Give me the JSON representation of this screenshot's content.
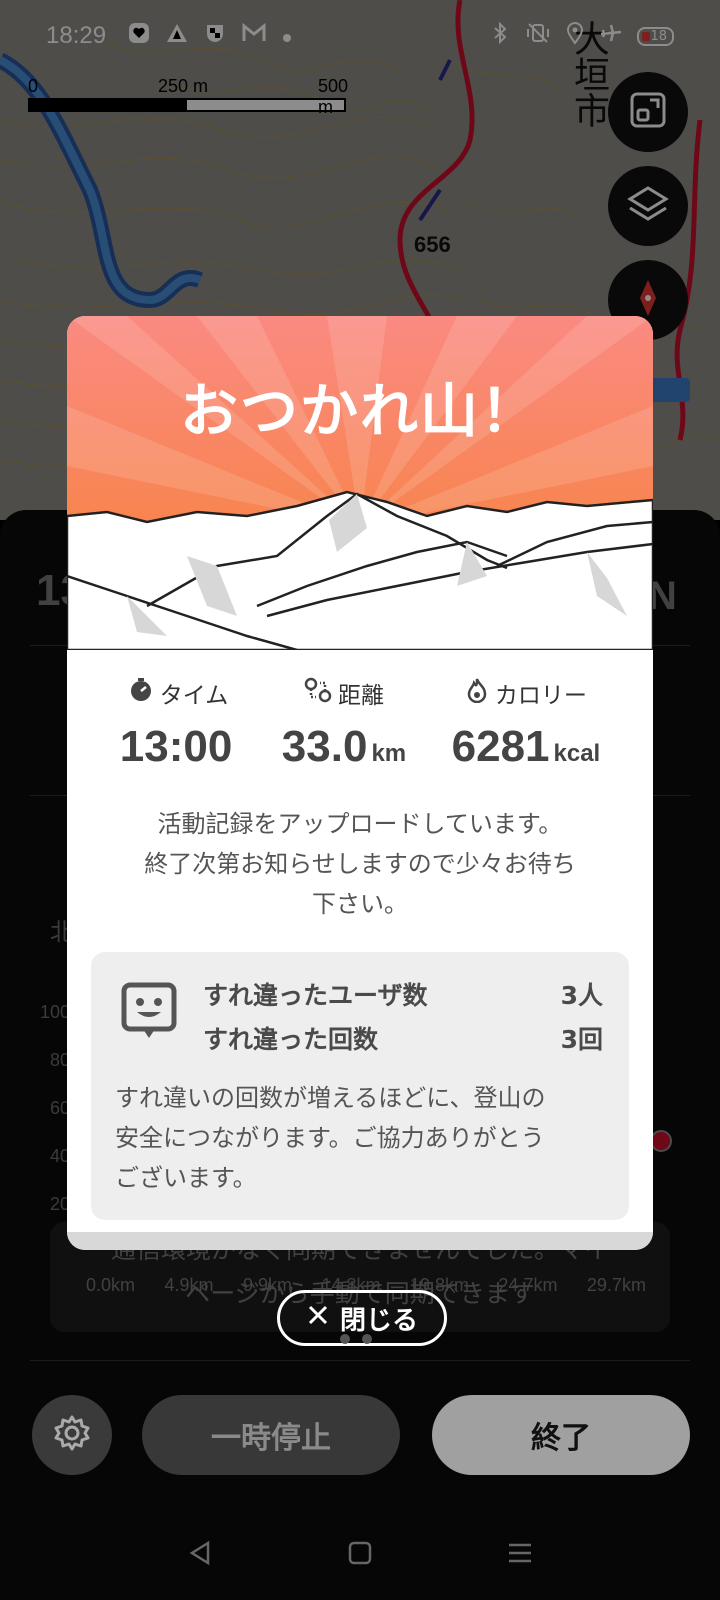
{
  "status_bar": {
    "time": "18:29",
    "battery": "18",
    "icons": [
      "heart-badge-icon",
      "triangle-icon",
      "shield-icon",
      "gmail-icon",
      "dot-icon",
      "bluetooth-icon",
      "vibrate-icon",
      "location-icon",
      "airplane-icon"
    ]
  },
  "map": {
    "scale_labels": [
      "0",
      "250 m",
      "500 m"
    ],
    "elevation_label": "656",
    "place_name": "大垣市",
    "buttons": [
      "fullscreen-icon",
      "layers-icon",
      "compass-icon"
    ]
  },
  "modal": {
    "title": "おつかれ山！",
    "stats": [
      {
        "icon": "stopwatch-icon",
        "label": "タイム",
        "value": "13:00",
        "unit": ""
      },
      {
        "icon": "route-icon",
        "label": "距離",
        "value": "33.0",
        "unit": "km"
      },
      {
        "icon": "flame-icon",
        "label": "カロリー",
        "value": "6281",
        "unit": "kcal"
      }
    ],
    "upload_message_lines": [
      "活動記録をアップロードしています。",
      "終了次第お知らせしますので少々お待ち",
      "下さい。"
    ],
    "pass_box": {
      "rows": [
        {
          "label": "すれ違ったユーザ数",
          "value": "3人"
        },
        {
          "label": "すれ違った回数",
          "value": "3回"
        }
      ],
      "note_lines": [
        "すれ違いの回数が増えるほどに、登山の",
        "安全につながります。ご協力ありがとう",
        "ございます。"
      ]
    },
    "close_label": "閉じる"
  },
  "background": {
    "big_number": "13",
    "north_letter": "N",
    "side_label": "北",
    "y_ticks": [
      "100",
      "80",
      "60",
      "40",
      "20"
    ],
    "x_ticks": [
      "0.0km",
      "4.9km",
      "9.9km",
      "14.8km",
      "19.8km",
      "24.7km",
      "29.7km"
    ],
    "sync_message_lines": [
      "通信環境がなく同期できませんでした。マイ",
      "ページから手動で同期できます"
    ]
  },
  "bottom_bar": {
    "pause_label": "一時停止",
    "end_label": "終了"
  },
  "colors": {
    "hero_top": "#fa8a7f",
    "hero_bottom": "#f7823a",
    "route": "#c8102e"
  }
}
